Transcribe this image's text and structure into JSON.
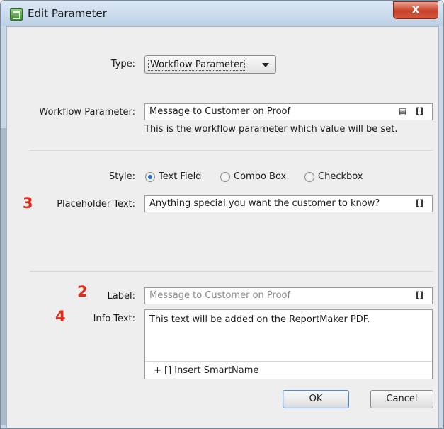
{
  "window": {
    "title": "Edit Parameter",
    "close_label": "X"
  },
  "type": {
    "label": "Type:",
    "value": "Workflow Parameter"
  },
  "workflow_parameter": {
    "label": "Workflow Parameter:",
    "value": "Message to Customer on Proof",
    "hint": "This is the workflow parameter which value will be set."
  },
  "style": {
    "label": "Style:",
    "options": [
      "Text Field",
      "Combo Box",
      "Checkbox"
    ],
    "selected": "Text Field"
  },
  "placeholder_text": {
    "marker": "3",
    "label": "Placeholder Text:",
    "value": "Anything special you want the customer to know?"
  },
  "label_field": {
    "marker": "2",
    "label": "Label:",
    "placeholder": "Message to Customer on Proof"
  },
  "info_text": {
    "marker": "4",
    "label": "Info Text:",
    "value": "This text will be added on the ReportMaker PDF.",
    "insert_label": "+ [] Insert SmartName"
  },
  "smartname_icon": "[]",
  "buttons": {
    "ok": "OK",
    "cancel": "Cancel"
  },
  "colors": {
    "marker": "#e32b1c",
    "radio_selected": "#1f6fcf",
    "close_button": "#c6412a"
  }
}
